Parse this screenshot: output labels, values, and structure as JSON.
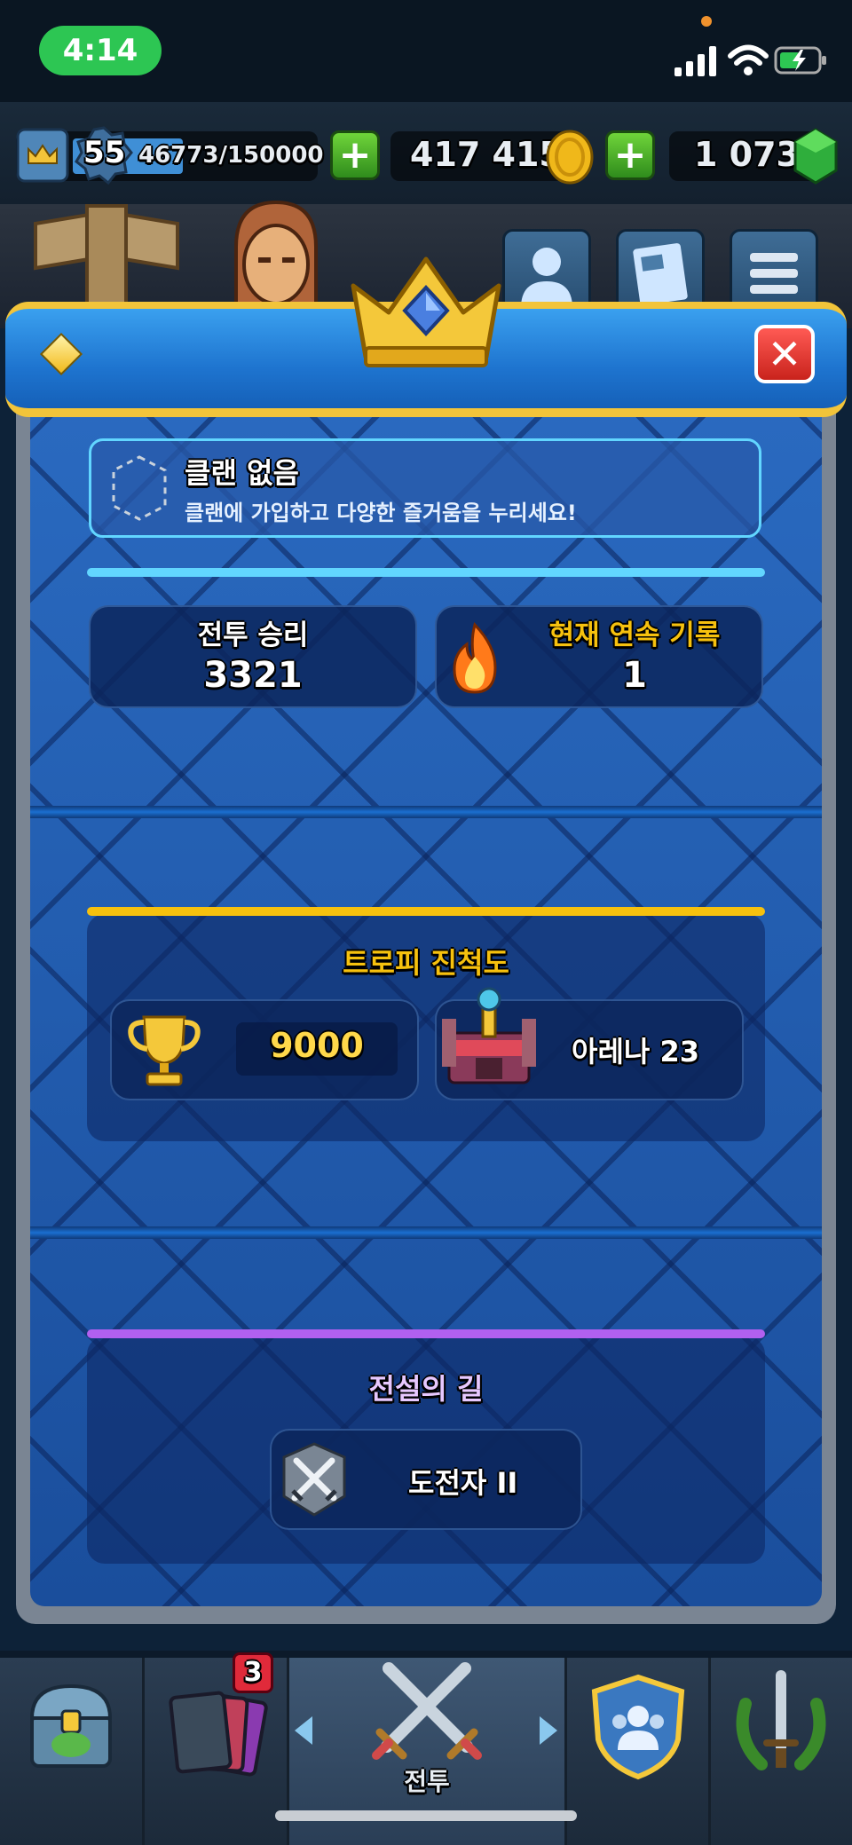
{
  "status_bar": {
    "time": "4:14"
  },
  "hud": {
    "level": "55",
    "xp": "46773/150000",
    "gold": "417 415",
    "gems": "1 073"
  },
  "clan": {
    "title": "클랜 없음",
    "subtitle": "클랜에 가입하고 다양한 즐거움을 누리세요!"
  },
  "battle_stats": {
    "wins_label": "전투 승리",
    "wins_value": "3321",
    "streak_label": "현재 연속 기록",
    "streak_value": "1"
  },
  "trophy_progress": {
    "title": "트로피 진척도",
    "trophies": "9000",
    "arena_label": "아레나",
    "arena_number": "23"
  },
  "path_of_legends": {
    "title": "전설의 길",
    "rank": "도전자",
    "rank_numeral": "II"
  },
  "bottom_nav": {
    "cards_badge": "3",
    "battle_label": "전투"
  },
  "colors": {
    "gold_accent": "#f2c43a",
    "divider_cyan": "#62d6ff",
    "divider_gold": "#f6c10e",
    "divider_purple": "#b160f0",
    "streak_label_color": "#f6c10e",
    "path_title_color": "#e7c8ff"
  }
}
